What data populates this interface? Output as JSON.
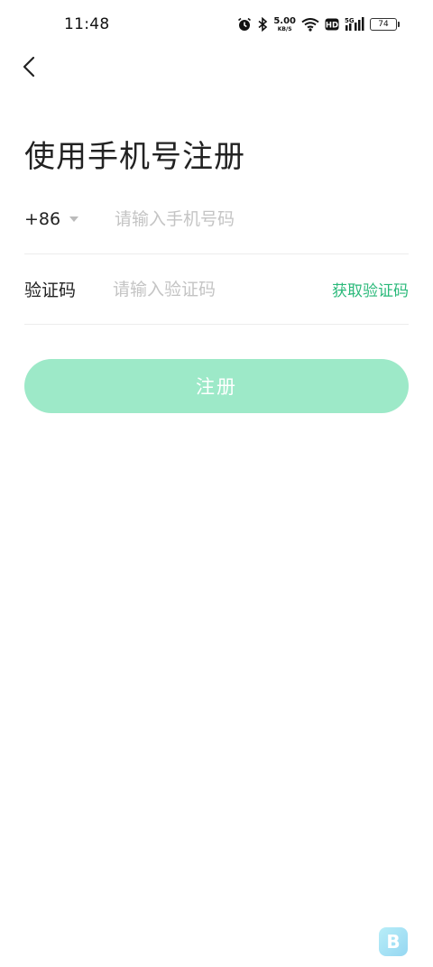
{
  "status_bar": {
    "time": "11:48",
    "net_speed_value": "5.00",
    "net_speed_unit": "KB/S",
    "network": "5G",
    "hd": "HD",
    "battery_level": "74",
    "icons": [
      "alarm-icon",
      "bluetooth-icon",
      "wifi-icon",
      "hd-icon",
      "signal-icon",
      "battery-icon"
    ]
  },
  "header": {
    "back_icon": "chevron-left-icon",
    "title": "使用手机号注册"
  },
  "phone_row": {
    "country_code": "+86",
    "placeholder": "请输入手机号码"
  },
  "code_row": {
    "label": "验证码",
    "placeholder": "请输入验证码",
    "get_code": "获取验证码"
  },
  "register_button": {
    "label": "注册"
  },
  "colors": {
    "accent": "#2ab97a",
    "button_disabled": "#9de9c8",
    "placeholder": "#c4c4c4",
    "divider": "#ececec"
  }
}
